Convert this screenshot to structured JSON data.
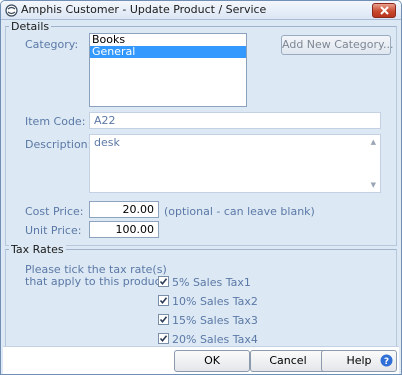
{
  "window": {
    "title": "Amphis Customer - Update Product / Service"
  },
  "details": {
    "group_label": "Details",
    "category_label": "Category:",
    "categories": [
      "Books",
      "General"
    ],
    "selected_category": "General",
    "add_category_button": "Add New Category...",
    "item_code_label": "Item Code:",
    "item_code_value": "A22",
    "description_label": "Description:",
    "description_value": "desk",
    "cost_price_label": "Cost Price:",
    "cost_price_value": "20.00",
    "cost_price_hint": "(optional - can leave blank)",
    "unit_price_label": "Unit Price:",
    "unit_price_value": "100.00"
  },
  "tax_rates": {
    "group_label": "Tax Rates",
    "instruction_line1": "Please tick the tax rate(s)",
    "instruction_line2": "that apply to this product",
    "options": [
      {
        "label": "5% Sales Tax1",
        "checked": true
      },
      {
        "label": "10% Sales Tax2",
        "checked": true
      },
      {
        "label": "15% Sales Tax3",
        "checked": true
      },
      {
        "label": "20% Sales Tax4",
        "checked": true
      }
    ]
  },
  "buttons": {
    "ok": "OK",
    "cancel": "Cancel",
    "help": "Help"
  },
  "colors": {
    "label_blue": "#5b78a6",
    "selection": "#3399ff",
    "dialog_background": "#dce9f4"
  }
}
